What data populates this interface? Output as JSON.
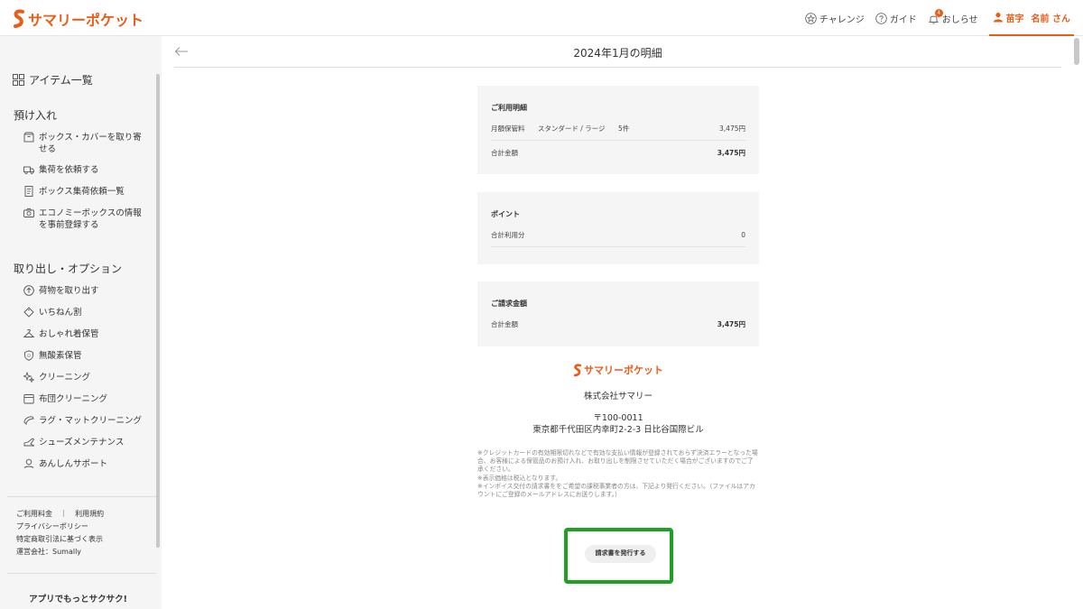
{
  "header": {
    "logo_text": "サマリーポケット",
    "nav": {
      "challenge": "チャレンジ",
      "guide": "ガイド",
      "notifications": "おしらせ",
      "notification_count": "4",
      "user_family": "苗字",
      "user_given": "名前 さん"
    }
  },
  "sidebar": {
    "items_list": "アイテム一覧",
    "section_deposit": "預け入れ",
    "deposit_items": [
      "ボックス・カバーを取り寄せる",
      "集荷を依頼する",
      "ボックス集荷依頼一覧",
      "エコノミーボックスの情報を事前登録する"
    ],
    "section_options": "取り出し・オプション",
    "option_items": [
      "荷物を取り出す",
      "いちねん割",
      "おしゃれ着保管",
      "無酸素保管",
      "クリーニング",
      "布団クリーニング",
      "ラグ・マットクリーニング",
      "シューズメンテナンス",
      "あんしんサポート"
    ],
    "footer_links": {
      "pricing": "ご利用料金",
      "separator": "｜",
      "terms": "利用規約",
      "privacy": "プライバシーポリシー",
      "commerce": "特定商取引法に基づく表示",
      "company": "運営会社：Sumally"
    },
    "app_promo": "アプリでもっとサクサク!"
  },
  "main": {
    "title": "2024年1月の明細",
    "usage": {
      "heading": "ご利用明細",
      "row1_label": "月額保管料",
      "row1_plan": "スタンダード / ラージ",
      "row1_count": "5件",
      "row1_value": "3,475円",
      "total_label": "合計金額",
      "total_value": "3,475円"
    },
    "points": {
      "heading": "ポイント",
      "used_label": "合計利用分",
      "used_value": "0"
    },
    "billing": {
      "heading": "ご請求金額",
      "total_label": "合計金額",
      "total_value": "3,475円"
    },
    "company": {
      "logo_text": "サマリーポケット",
      "name": "株式会社サマリー",
      "zip": "〒100-0011",
      "address": "東京都千代田区内幸町2-2-3 日比谷国際ビル"
    },
    "notes": [
      "※クレジットカードの有効期限切れなどで有効な支払い情報が登録されておらず決済エラーとなった場合、お客様による保管品のお預け入れ、お取り出しを制限させていただく場合がございますのでご了承ください。",
      "※表示価格は税込となります。",
      "※インボイス交付の請求書ををご希望の課税事業者の方は、下記より発行ください。（ファイルはアカウントにご登録のメールアドレスにお送りします。）"
    ],
    "issue_button": "請求書を発行する"
  },
  "colors": {
    "brand": "#ea5b16",
    "highlight": "#1ea023"
  }
}
